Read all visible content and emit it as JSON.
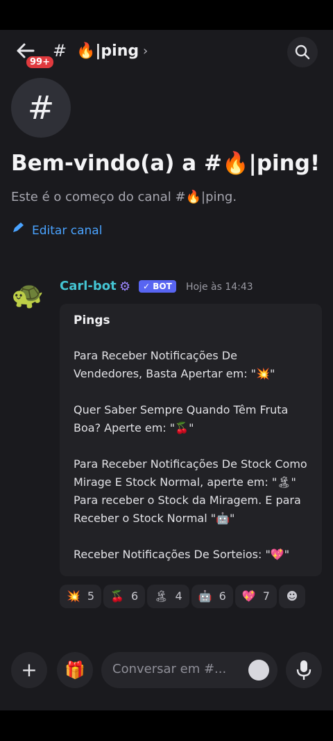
{
  "header": {
    "unread_badge": "99+",
    "hash": "#",
    "channel_name": "🔥|ping",
    "chevron": "›"
  },
  "channel_intro": {
    "avatar_glyph": "#",
    "title": "Bem-vindo(a) a #🔥|ping!",
    "subtitle": "Este é o começo do canal #🔥|ping.",
    "edit_label": "Editar canal"
  },
  "message": {
    "author_avatar": "🐢",
    "author": "Carl-bot",
    "author_icon": "⚙",
    "bot_tag": "✓ BOT",
    "timestamp": "Hoje às 14:43",
    "embed": {
      "title": "Pings",
      "lines": [
        "Para Receber Notificações De Vendedores, Basta Apertar em: \"💥\"",
        "Quer Saber Sempre Quando Têm Fruta Boa? Aperte em: \"🍒\"",
        "Para Receber Notificações De Stock Como Mirage E Stock Normal, aperte em: \"🏝\" Para receber o Stock da Miragem.  E para Receber o Stock Normal \"🤖\"",
        "Receber Notificações De Sorteios: \"💖\""
      ]
    },
    "reactions": [
      {
        "emoji": "💥",
        "count": "5"
      },
      {
        "emoji": "🍒",
        "count": "6"
      },
      {
        "emoji": "🏝",
        "count": "4"
      },
      {
        "emoji": "🤖",
        "count": "6"
      },
      {
        "emoji": "💖",
        "count": "7"
      }
    ],
    "add_reaction_glyph": "☻"
  },
  "composer": {
    "add_glyph": "+",
    "gift_glyph": "🎁",
    "placeholder": "Conversar em #...",
    "mic_icon": "microphone-icon"
  },
  "colors": {
    "background": "#1a1a1e",
    "link": "#4aa3ff",
    "author": "#44c4d2",
    "bot_tag": "#5865f2",
    "badge": "#e03a3e"
  }
}
